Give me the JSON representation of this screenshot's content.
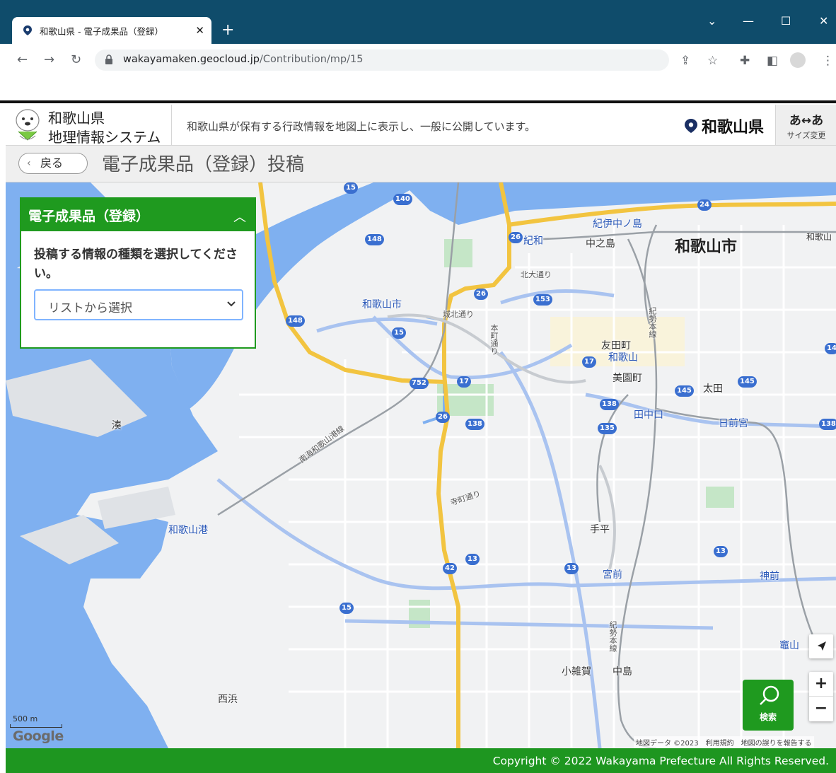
{
  "browser": {
    "tab_title": "和歌山県 - 電子成果品（登録）",
    "new_tab": "+",
    "window_minimize": "—",
    "window_maximize": "☐",
    "window_close": "✕",
    "window_chevron": "⌄",
    "url_host": "wakayamaken.geocloud.jp",
    "url_path": "/Contribution/mp/15"
  },
  "header": {
    "logo_line1": "和歌山県",
    "logo_line2": "地理情報システム",
    "tagline": "和歌山県が保有する行政情報を地図上に表示し、一般に公開しています。",
    "pref_name": "和歌山県",
    "size_button_top": "あ↔あ",
    "size_button_bottom": "サイズ変更"
  },
  "title_bar": {
    "back_label": "戻る",
    "page_title": "電子成果品（登録）投稿"
  },
  "panel": {
    "title": "電子成果品（登録）",
    "prompt": "投稿する情報の種類を選択してください。",
    "select_value": "リストから選択"
  },
  "map": {
    "labels": {
      "city": "和歌山市",
      "minato": "湊",
      "nishihama": "西浜",
      "wakayamashi_station": "和歌山市",
      "wakayama_port": "和歌山港",
      "kinokawa_nakanoshima": "紀伊中ノ島",
      "kiwa": "紀和",
      "nakanoshima": "中之島",
      "tomodacho": "友田町",
      "wakayama_station": "和歌山",
      "misonocho": "美園町",
      "ota": "太田",
      "tanakaguchi": "田中口",
      "hinokuma": "日前宮",
      "tebira": "手平",
      "miyamae": "宮前",
      "kamimae": "神前",
      "kamayama": "竈山",
      "kozaka": "小雑賀",
      "nakajima": "中島",
      "wakayama_east": "和歌山",
      "kitaodori": "北大通り",
      "jokitadori": "城北通り",
      "honmachidori": "本町通り",
      "nankai": "南海和歌山港線",
      "teramachi": "寺町通り",
      "kisei": "紀勢本線",
      "kisei2": "紀勢本線"
    },
    "shields": [
      "15",
      "140",
      "148",
      "24",
      "26",
      "26",
      "153",
      "148",
      "15",
      "17",
      "752",
      "17",
      "145",
      "145",
      "138",
      "138",
      "135",
      "138",
      "26",
      "13",
      "13",
      "13",
      "42",
      "15",
      "14"
    ],
    "scale_label": "500 m",
    "google_logo": "Google",
    "attribution": "地図データ ©2023　利用規約　地図の誤りを報告する",
    "search_label": "検索",
    "zoom_in": "+",
    "zoom_out": "−"
  },
  "footer": {
    "copyright": "Copyright © 2022 Wakayama Prefecture All Rights Reserved."
  },
  "colors": {
    "brand_green": "#1f9a1f",
    "tabbar": "#0f4c6b",
    "water": "#7fb0f0",
    "highway": "#f7c64a",
    "road_blue": "#8fb4ee"
  }
}
